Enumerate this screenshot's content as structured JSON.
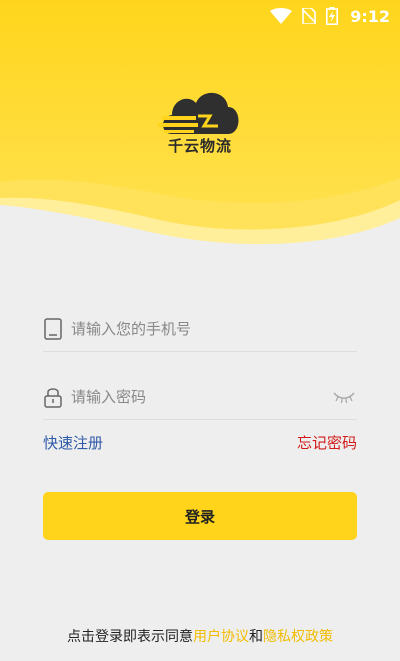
{
  "status_bar": {
    "time": "9:12"
  },
  "brand": {
    "name": "千云物流"
  },
  "login_form": {
    "phone_placeholder": "请输入您的手机号",
    "password_placeholder": "请输入密码",
    "register_link": "快速注册",
    "forgot_link": "忘记密码",
    "login_button": "登录"
  },
  "agreement": {
    "prefix": "点击登录即表示同意",
    "user_agreement": "用户协议",
    "conjunction": "和",
    "privacy_policy": "隐私权政策"
  },
  "colors": {
    "header_yellow": "#ffd41a",
    "button_yellow": "#ffd41a",
    "register_link": "#2f5aa8",
    "forgot_link": "#d21a1a",
    "agreement_link": "#f2bd00",
    "background": "#eeeeee"
  }
}
